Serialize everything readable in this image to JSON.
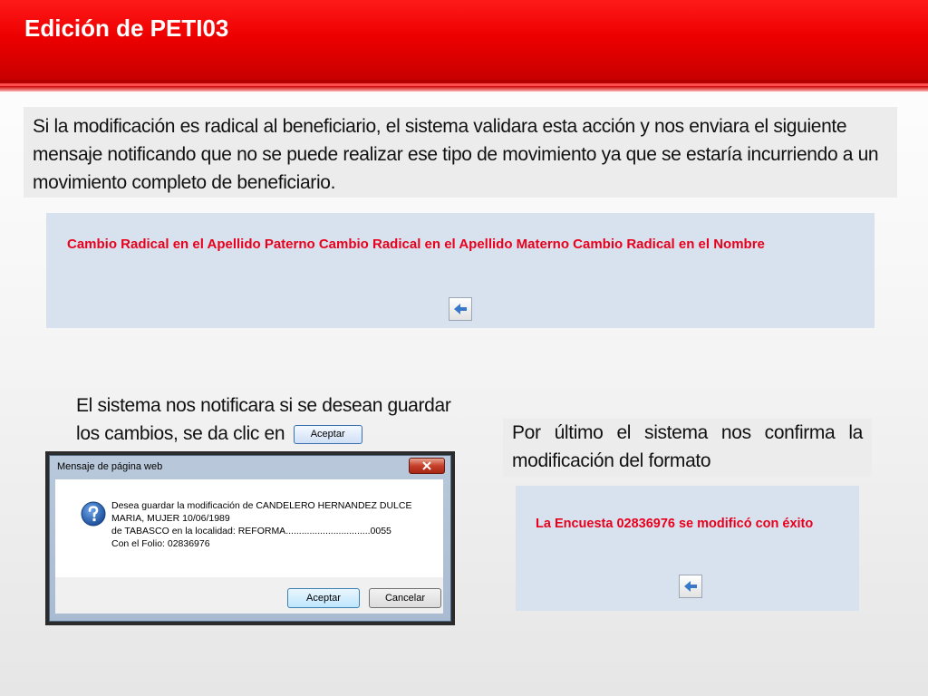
{
  "header": {
    "title": "Edición de PETI03"
  },
  "intro": {
    "text": "Si la modificación es radical al beneficiario, el sistema validara esta acción y nos enviara el siguiente mensaje notificando que no se puede realizar ese tipo de movimiento ya que se estaría incurriendo a un movimiento completo de beneficiario."
  },
  "radical_panel": {
    "message": "Cambio Radical en el Apellido Paterno Cambio Radical en el Apellido Materno Cambio Radical en el Nombre",
    "back_icon": "back-arrow-icon"
  },
  "save_note": {
    "text": "El sistema nos notificara si se desean guardar los cambios, se da clic en",
    "button_label": "Aceptar"
  },
  "dialog": {
    "title": "Mensaje de página web",
    "icon": "question-icon",
    "message_lines": [
      "Desea guardar la modificación de CANDELERO HERNANDEZ DULCE",
      "MARIA, MUJER  10/06/1989",
      " de TABASCO en la localidad: REFORMA................................0055",
      " Con el Folio: 02836976"
    ],
    "accept_label": "Aceptar",
    "cancel_label": "Cancelar"
  },
  "confirm_note": {
    "text": "Por último el sistema nos confirma la modificación del formato"
  },
  "success_panel": {
    "message": "La Encuesta 02836976 se modificó con éxito",
    "back_icon": "back-arrow-icon"
  },
  "colors": {
    "header_red": "#ee0000",
    "alert_text": "#e8001c",
    "panel_blue": "#d8e2ef"
  }
}
